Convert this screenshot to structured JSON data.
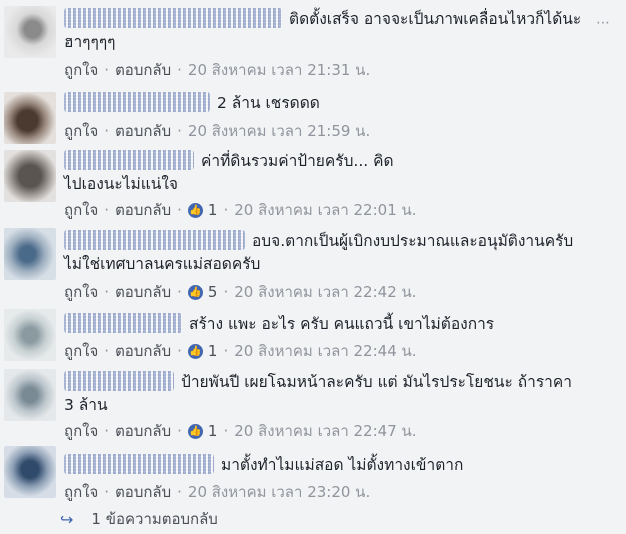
{
  "labels": {
    "like": "ถูกใจ",
    "reply": "ตอบกลับ",
    "separator": "·"
  },
  "comments": [
    {
      "text": "ติดตั้งเสร็จ อาจจะเป็นภาพเคลื่อนไหวก็ได้นะ ฮาๆๆๆๆ",
      "time": "20 สิงหาคม เวลา 21:31 น.",
      "likes": null
    },
    {
      "text": "2 ล้าน เชรดดด",
      "time": "20 สิงหาคม เวลา 21:59 น.",
      "likes": null
    },
    {
      "text": "ค่าที่ดินรวมค่าป้ายครับ... คิดไปเองนะไม่แน่ใจ",
      "time": "20 สิงหาคม เวลา 22:01 น.",
      "likes": "1"
    },
    {
      "text": "อบจ.ตากเป็นผู้เบิกงบประมาณและอนุมัติงานครับ ไม่ใช่เทศบาลนครแม่สอดครับ",
      "time": "20 สิงหาคม เวลา 22:42 น.",
      "likes": "5"
    },
    {
      "text": "สร้าง แพะ อะไร ครับ คนแถวนี้ เขาไม่ต้องการ",
      "time": "20 สิงหาคม เวลา 22:44 น.",
      "likes": "1"
    },
    {
      "text": "ป้ายพันปี เผยโฉมหน้าละครับ แต่ มันไรประโยชนะ ถ้าราคา 3 ล้าน",
      "time": "20 สิงหาคม เวลา 22:47 น.",
      "likes": "1"
    },
    {
      "text": "มาตั้งทำไมแม่สอด ไม่ตั้งทางเข้าตาก",
      "time": "20 สิงหาคม เวลา 23:20 น.",
      "likes": null
    }
  ],
  "replies": {
    "label": "1 ข้อความตอบกลับ"
  },
  "colors": {
    "accent": "#4267b2",
    "meta": "#90949c",
    "background": "#f2f3f5"
  }
}
